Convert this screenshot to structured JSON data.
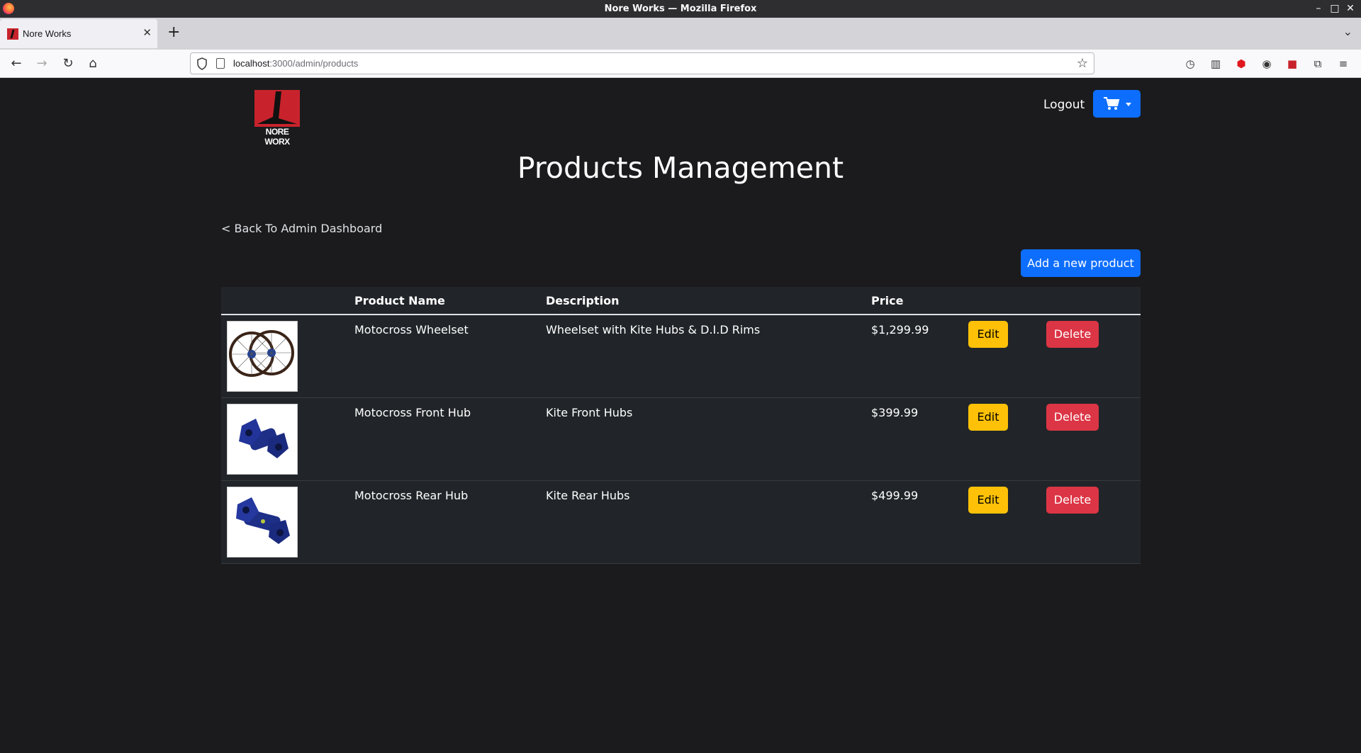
{
  "window": {
    "title": "Nore Works — Mozilla Firefox"
  },
  "browser": {
    "tab_title": "Nore Works",
    "url_host": "localhost",
    "url_path": ":3000/admin/products"
  },
  "header": {
    "logo_text": "NORE WORX",
    "logout_label": "Logout"
  },
  "page": {
    "title": "Products Management",
    "back_link": "< Back To Admin Dashboard",
    "add_button": "Add a new product"
  },
  "table": {
    "columns": [
      "",
      "Product Name",
      "Description",
      "Price",
      "",
      ""
    ],
    "rows": [
      {
        "name": "Motocross Wheelset",
        "description": "Wheelset with Kite Hubs & D.I.D Rims",
        "price": "$1,299.99",
        "image": "wheelset-image",
        "edit": "Edit",
        "delete": "Delete"
      },
      {
        "name": "Motocross Front Hub",
        "description": "Kite Front Hubs",
        "price": "$399.99",
        "image": "front-hub-image",
        "edit": "Edit",
        "delete": "Delete"
      },
      {
        "name": "Motocross Rear Hub",
        "description": "Kite Rear Hubs",
        "price": "$499.99",
        "image": "rear-hub-image",
        "edit": "Edit",
        "delete": "Delete"
      }
    ]
  },
  "colors": {
    "background": "#1b1b1d",
    "primary": "#0d6efd",
    "warning": "#ffc107",
    "danger": "#dc3545",
    "brand_red": "#c8232c"
  }
}
